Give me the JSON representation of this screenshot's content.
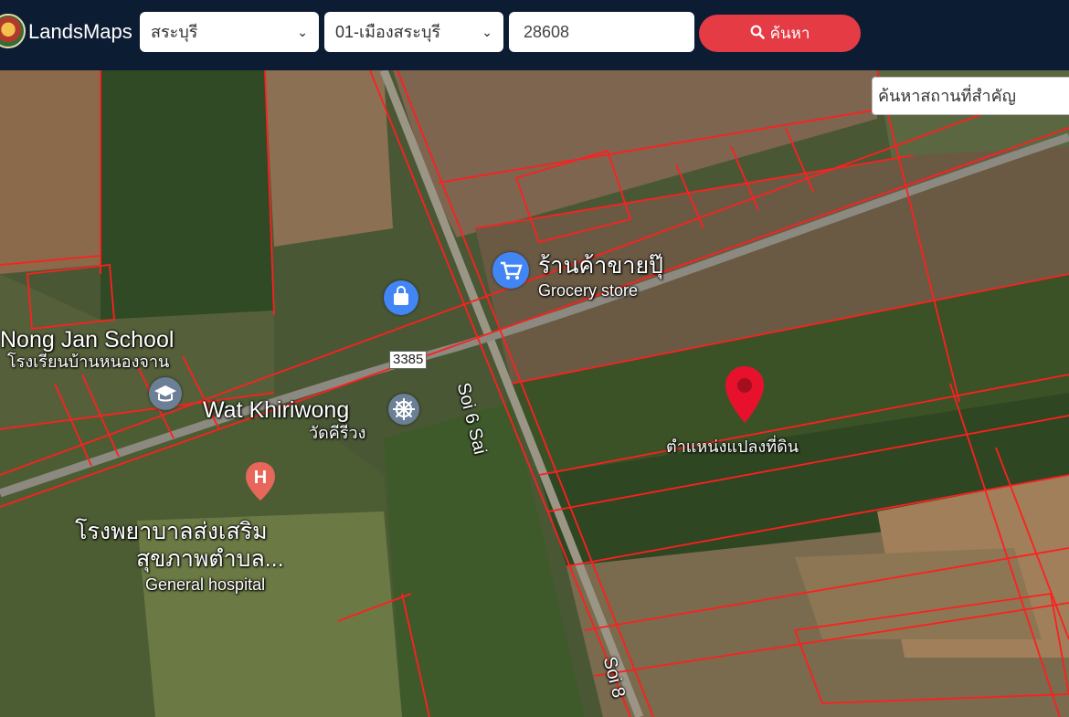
{
  "header": {
    "brand": "LandsMaps",
    "province": "สระบุรี",
    "district": "01-เมืองสระบุรี",
    "parcel_number": "28608",
    "search_button": "ค้นหา"
  },
  "place_search": {
    "placeholder": "ค้นหาสถานที่สำคัญ"
  },
  "map": {
    "parcel_marker_label": "ตำแหน่งแปลงที่ดิน",
    "road_badge": "3385",
    "places": [
      {
        "name_en": "Nong Jan School",
        "name_th": "โรงเรียนบ้านหนองจาน"
      },
      {
        "name_th": "ร้านค้าขายปุ๊",
        "category": "Grocery store"
      },
      {
        "name_en": "Wat Khiriwong",
        "name_th": "วัดคีรีวง"
      },
      {
        "name_th_1": "โรงพยาบาลส่งเสริม",
        "name_th_2": "สุขภาพตำบล...",
        "category": "General hospital"
      }
    ],
    "streets": [
      "Soi 6 Sai",
      "Soi 8"
    ]
  },
  "colors": {
    "header_bg": "#0c1c33",
    "search_button": "#e53b45",
    "parcel_lines": "#ff1f1f",
    "marker": "#e8112d"
  }
}
